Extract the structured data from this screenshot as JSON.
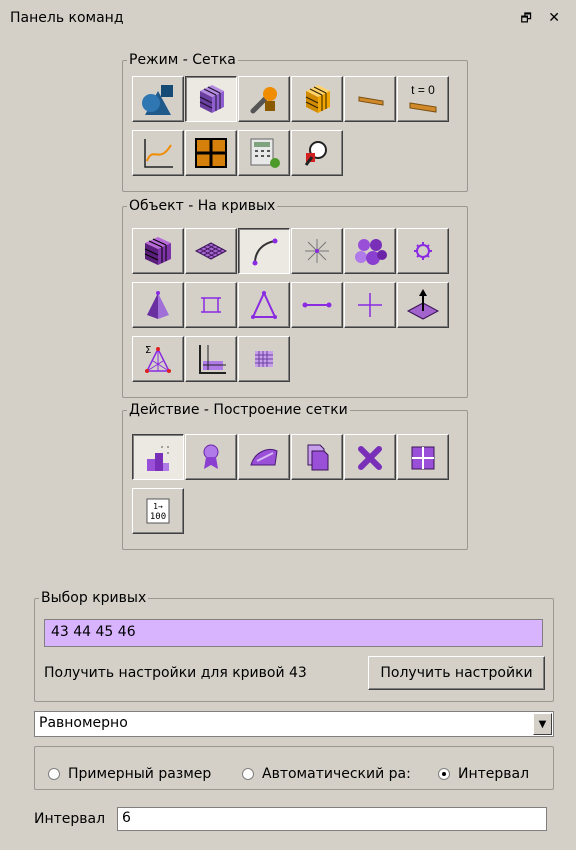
{
  "panel": {
    "title": "Панель команд",
    "float_icon": "restore-icon",
    "close_icon": "close-icon"
  },
  "mode_group": {
    "legend": "Режим - Сетка",
    "buttons": [
      {
        "icon": "geometry-shapes-icon"
      },
      {
        "icon": "mesh-cube-icon",
        "pressed": true
      },
      {
        "icon": "tools-icon"
      },
      {
        "icon": "orange-cube-icon"
      },
      {
        "icon": "surface-strip-icon"
      },
      {
        "icon": "time-zero-icon",
        "text": "t = 0"
      },
      {
        "icon": "graph-plot-icon"
      },
      {
        "icon": "grid-orange-icon"
      },
      {
        "icon": "calculator-icon"
      },
      {
        "icon": "zoom-icon"
      }
    ]
  },
  "object_group": {
    "legend": "Объект - На кривых",
    "buttons": [
      {
        "icon": "volume-mesh-icon"
      },
      {
        "icon": "face-mesh-icon"
      },
      {
        "icon": "curve-icon",
        "pressed": true
      },
      {
        "icon": "point-star-icon"
      },
      {
        "icon": "parts-cluster-icon"
      },
      {
        "icon": "small-gear-icon"
      },
      {
        "icon": "pyramid-icon"
      },
      {
        "icon": "square-edges-icon"
      },
      {
        "icon": "triangle-icon"
      },
      {
        "icon": "line-segment-icon"
      },
      {
        "icon": "cross-icon"
      },
      {
        "icon": "normal-arrow-icon"
      },
      {
        "icon": "sigma-network-icon"
      },
      {
        "icon": "angle-grid-icon"
      },
      {
        "icon": "small-grid-icon"
      }
    ]
  },
  "action_group": {
    "legend": "Действие - Построение сетки",
    "buttons": [
      {
        "icon": "mesh-build-icon",
        "pressed": true
      },
      {
        "icon": "award-icon"
      },
      {
        "icon": "iron-icon"
      },
      {
        "icon": "copy-pages-icon"
      },
      {
        "icon": "delete-x-icon"
      },
      {
        "icon": "quad-split-icon"
      },
      {
        "icon": "numbering-icon",
        "text": "1→\n100"
      }
    ]
  },
  "curves_group": {
    "legend": "Выбор кривых",
    "value": "43 44 45 46",
    "info": "Получить настройки для кривой 43",
    "get_button": "Получить настройки"
  },
  "distribution": {
    "value": "Равномерно"
  },
  "radios": [
    {
      "label": "Примерный размер",
      "checked": false
    },
    {
      "label": "Автоматический ра:",
      "checked": false
    },
    {
      "label": "Интервал",
      "checked": true
    }
  ],
  "interval": {
    "label": "Интервал",
    "value": "6"
  }
}
